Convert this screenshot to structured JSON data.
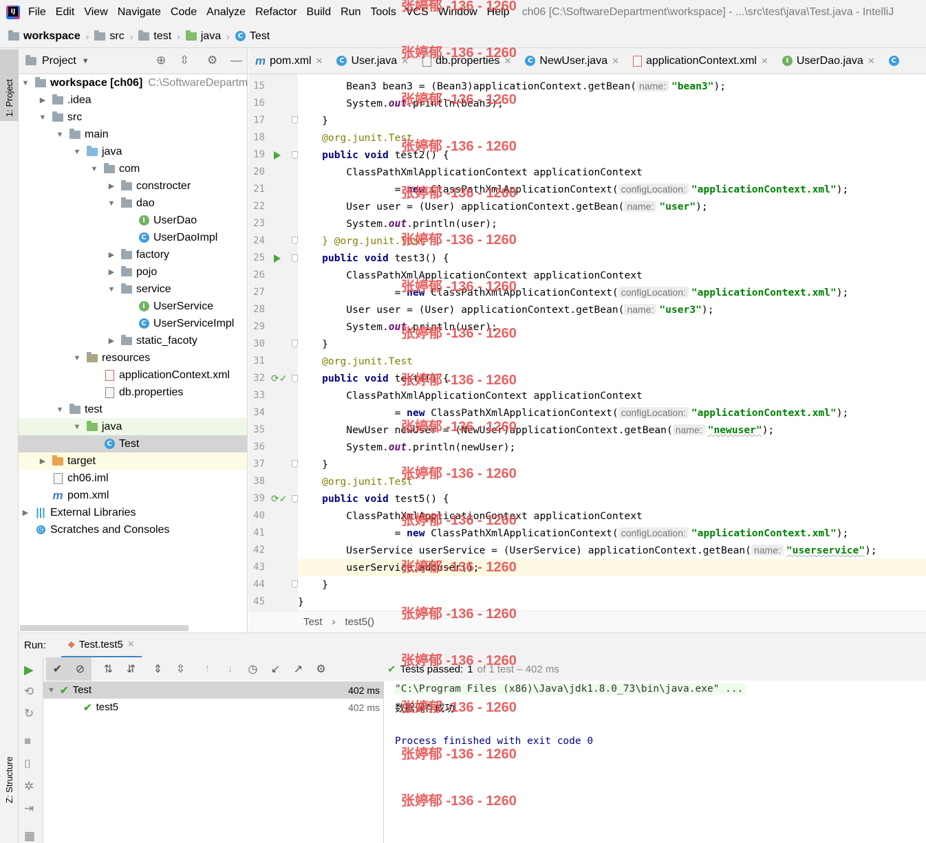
{
  "menubar": {
    "items": [
      "File",
      "Edit",
      "View",
      "Navigate",
      "Code",
      "Analyze",
      "Refactor",
      "Build",
      "Run",
      "Tools",
      "VCS",
      "Window",
      "Help"
    ],
    "title": "ch06 [C:\\SoftwareDepartment\\workspace] - ...\\src\\test\\java\\Test.java - IntelliJ"
  },
  "navbar": {
    "crumbs": [
      "workspace",
      "src",
      "test",
      "java",
      "Test"
    ]
  },
  "sidebar": {
    "project_tab": "1: Project",
    "structure_tab": "Z: Structure"
  },
  "project": {
    "header": "Project",
    "tree": [
      {
        "label": "workspace [ch06]",
        "extra": "C:\\SoftwareDepartm",
        "icon": "folder"
      },
      {
        "label": ".idea",
        "icon": "folder"
      },
      {
        "label": "src",
        "icon": "folder"
      },
      {
        "label": "main",
        "icon": "folder"
      },
      {
        "label": "java",
        "icon": "folder-source"
      },
      {
        "label": "com",
        "icon": "package"
      },
      {
        "label": "constrocter",
        "icon": "package"
      },
      {
        "label": "dao",
        "icon": "package"
      },
      {
        "label": "UserDao",
        "icon": "interface"
      },
      {
        "label": "UserDaoImpl",
        "icon": "class"
      },
      {
        "label": "factory",
        "icon": "package"
      },
      {
        "label": "pojo",
        "icon": "package"
      },
      {
        "label": "service",
        "icon": "package"
      },
      {
        "label": "UserService",
        "icon": "interface"
      },
      {
        "label": "UserServiceImpl",
        "icon": "class"
      },
      {
        "label": "static_facoty",
        "icon": "package"
      },
      {
        "label": "resources",
        "icon": "folder-resources"
      },
      {
        "label": "applicationContext.xml",
        "icon": "xml-file"
      },
      {
        "label": "db.properties",
        "icon": "properties-file"
      },
      {
        "label": "test",
        "icon": "folder"
      },
      {
        "label": "java",
        "icon": "folder-test"
      },
      {
        "label": "Test",
        "icon": "test-class"
      },
      {
        "label": "target",
        "icon": "folder-excluded"
      },
      {
        "label": "ch06.iml",
        "icon": "iml-file"
      },
      {
        "label": "pom.xml",
        "icon": "maven-file"
      },
      {
        "label": "External Libraries",
        "icon": "libraries"
      },
      {
        "label": "Scratches and Consoles",
        "icon": "scratches"
      }
    ]
  },
  "editor": {
    "tabs": [
      "pom.xml",
      "User.java",
      "db.properties",
      "NewUser.java",
      "applicationContext.xml",
      "UserDao.java"
    ],
    "line_numbers": [
      "15",
      "16",
      "17",
      "18",
      "19",
      "20",
      "21",
      "22",
      "23",
      "24",
      "25",
      "26",
      "27",
      "28",
      "29",
      "30",
      "31",
      "32",
      "33",
      "34",
      "35",
      "36",
      "37",
      "38",
      "39",
      "40",
      "41",
      "42",
      "43",
      "44",
      "45"
    ],
    "code": {
      "l15": {
        "a": "        Bean3 bean3 = (Bean3)applicationContext.getBean(",
        "hint": "name:",
        "s": "\"bean3\"",
        "b": ");"
      },
      "l16": {
        "a": "        System.",
        "f": "out",
        "b": ".println(bean3);"
      },
      "l17": "    }",
      "l18": "    @org.junit.Test",
      "l19": {
        "k": "public void",
        "b": " test2() {"
      },
      "l20": "        ClassPathXmlApplicationContext applicationContext",
      "l21": {
        "a": "                = ",
        "k": "new",
        "b": " ClassPathXmlApplicationContext(",
        "hint": "configLocation:",
        "s": "\"applicationContext.xml\"",
        "c": ");"
      },
      "l22": {
        "a": "        User user = (User) applicationContext.getBean(",
        "hint": "name:",
        "s": "\"user\"",
        "b": ");"
      },
      "l23": {
        "a": "        System.",
        "f": "out",
        "b": ".println(user);"
      },
      "l24": "    } @org.junit.Test",
      "l25": {
        "k": "public void",
        "b": " test3() {"
      },
      "l26": "        ClassPathXmlApplicationContext applicationContext",
      "l27": {
        "a": "                = ",
        "k": "new",
        "b": " ClassPathXmlApplicationContext(",
        "hint": "configLocation:",
        "s": "\"applicationContext.xml\"",
        "c": ");"
      },
      "l28": {
        "a": "        User user = (User) applicationContext.getBean(",
        "hint": "name:",
        "s": "\"user3\"",
        "b": ");"
      },
      "l29": {
        "a": "        System.",
        "f": "out",
        "b": ".println(user);"
      },
      "l30": "    }",
      "l31": "    @org.junit.Test",
      "l32": {
        "k": "public void",
        "b": " test4() {"
      },
      "l33": "        ClassPathXmlApplicationContext applicationContext",
      "l34": {
        "a": "                = ",
        "k": "new",
        "b": " ClassPathXmlApplicationContext(",
        "hint": "configLocation:",
        "s": "\"applicationContext.xml\"",
        "c": ");"
      },
      "l35": {
        "a": "        NewUser newUser = (NewUser)applicationContext.getBean(",
        "hint": "name:",
        "s": "\"newuser\"",
        "b": ");"
      },
      "l36": {
        "a": "        System.",
        "f": "out",
        "b": ".println(newUser);"
      },
      "l37": "    }",
      "l38": "    @org.junit.Test",
      "l39": {
        "k": "public void",
        "b": " test5() {"
      },
      "l40": "        ClassPathXmlApplicationContext applicationContext",
      "l41": {
        "a": "                = ",
        "k": "new",
        "b": " ClassPathXmlApplicationContext(",
        "hint": "configLocation:",
        "s": "\"applicationContext.xml\"",
        "c": ");"
      },
      "l42": {
        "a": "        UserService userService = (UserService) applicationContext.getBean(",
        "hint": "name:",
        "s": "\"userservice\"",
        "b": ");"
      },
      "l43": "        userService.adduser();",
      "l44": "    }",
      "l45": "}"
    },
    "breadcrumb": [
      "Test",
      "test5()"
    ]
  },
  "run": {
    "label": "Run:",
    "tab": "Test.test5",
    "status": {
      "prefix": "Tests passed:",
      "passed": "1",
      "suffix": "of 1 test – 402 ms"
    },
    "tree": [
      {
        "name": "Test",
        "duration": "402 ms"
      },
      {
        "name": "test5",
        "duration": "402 ms"
      }
    ],
    "console": [
      "\"C:\\Program Files (x86)\\Java\\jdk1.8.0_73\\bin\\java.exe\" ...",
      "数据保存成功",
      "",
      "Process finished with exit code 0"
    ]
  },
  "watermark": "张婷郁 -136 - 1260",
  "colors": {
    "keyword": "#000080",
    "string": "#008000",
    "static_field": "#660e7a",
    "annotation": "#808000",
    "run_green": "#49a73a",
    "watermark": "#e85050"
  }
}
